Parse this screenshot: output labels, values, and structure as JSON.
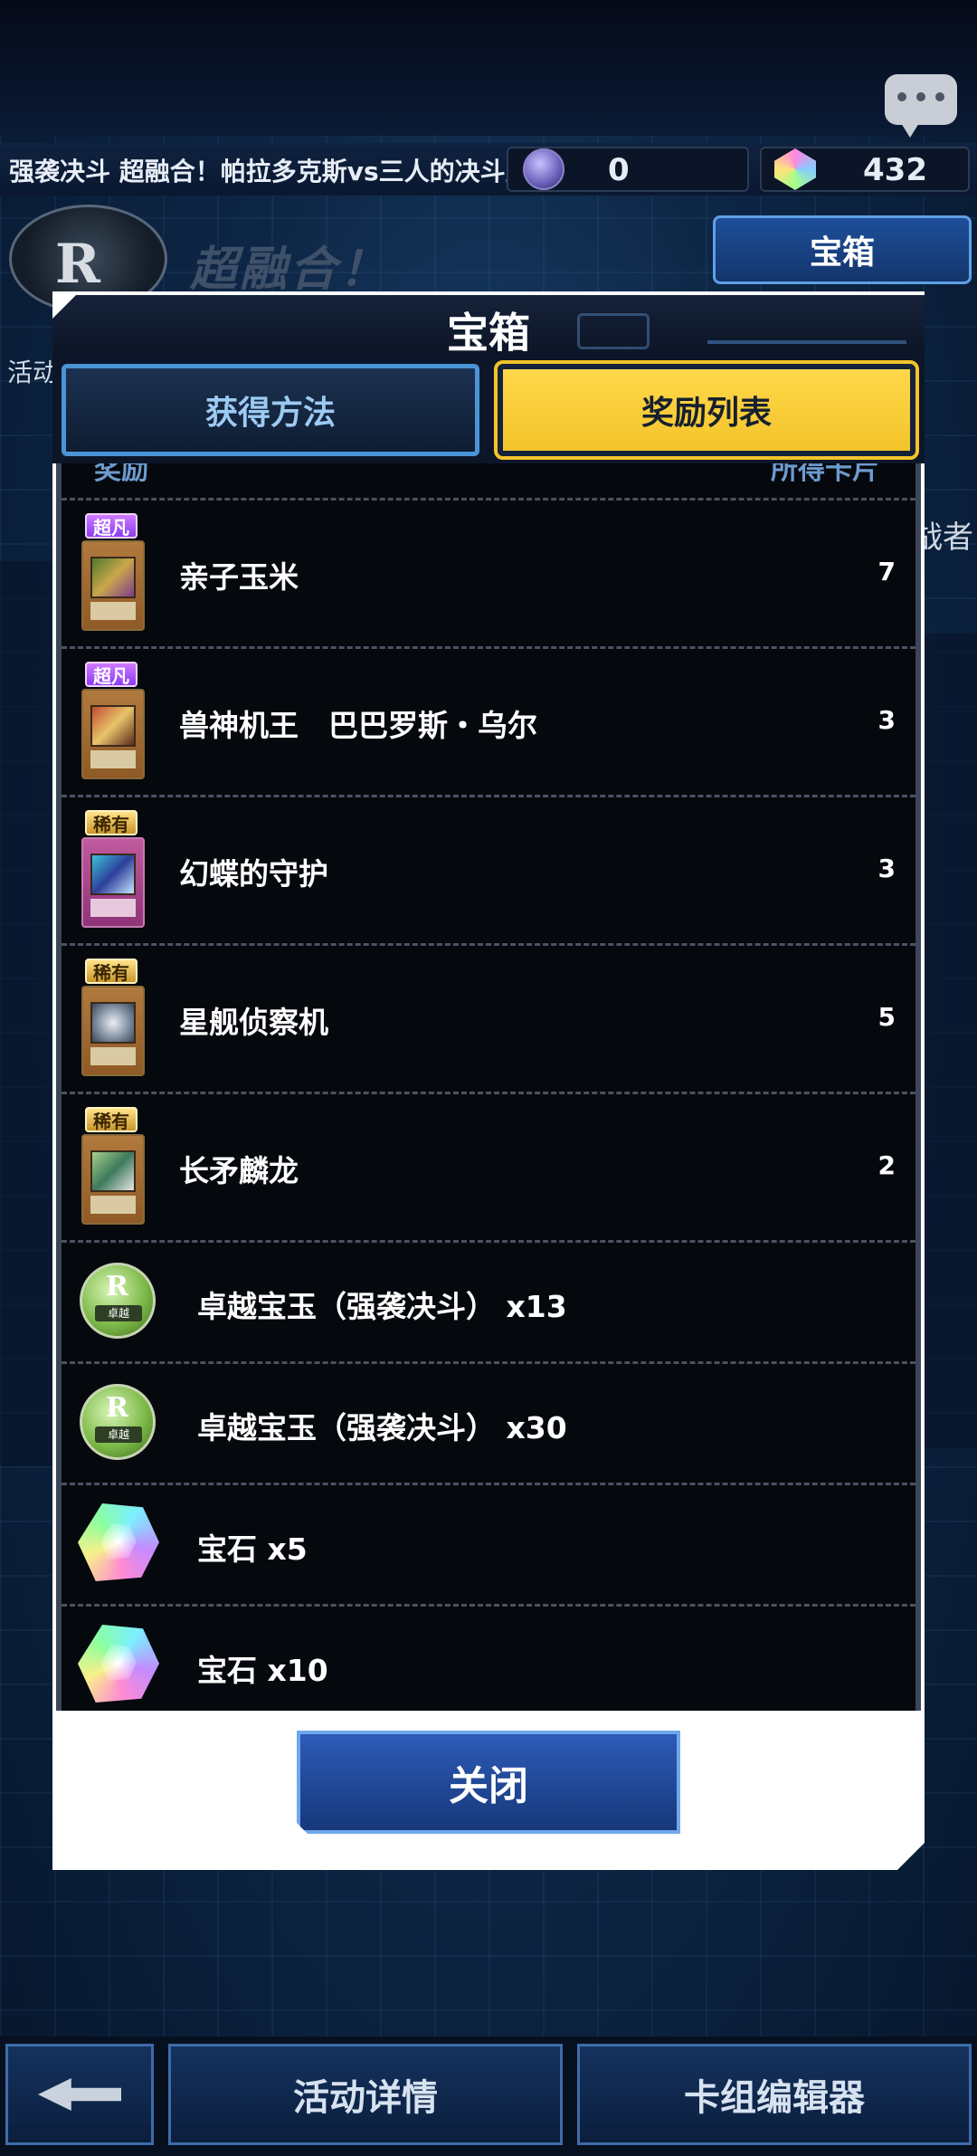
{
  "top_bar": {
    "event_title": "强袭决斗 超融合！帕拉多克斯vs三人的决斗王",
    "orb_count": "0",
    "gem_count": "432"
  },
  "banner": {
    "logo_letter": "R",
    "title": "超融合！",
    "treasure_button": "宝箱",
    "left_label": "活动",
    "right_label": "战者"
  },
  "modal": {
    "title": "宝箱",
    "tabs": [
      {
        "label": "获得方法",
        "active": false
      },
      {
        "label": "奖励列表",
        "active": true
      }
    ],
    "list_header": {
      "left": "奖励",
      "right": "所得卡片"
    },
    "card_rewards": [
      {
        "rarity": "超凡",
        "name": "亲子玉米",
        "qty": "7"
      },
      {
        "rarity": "超凡",
        "name": "兽神机王　巴巴罗斯・乌尔",
        "qty": "3"
      },
      {
        "rarity": "稀有",
        "name": "幻蝶的守护",
        "qty": "3"
      },
      {
        "rarity": "稀有",
        "name": "星舰侦察机",
        "qty": "5"
      },
      {
        "rarity": "稀有",
        "name": "长矛麟龙",
        "qty": "2"
      }
    ],
    "item_rewards": [
      {
        "icon": "medal-icon",
        "name": "卓越宝玉（强袭决斗） x13",
        "medal_label": "卓越"
      },
      {
        "icon": "medal-icon",
        "name": "卓越宝玉（强袭决斗） x30",
        "medal_label": "卓越"
      },
      {
        "icon": "gem-icon",
        "name": "宝石 x5"
      },
      {
        "icon": "gem-icon",
        "name": "宝石 x10"
      }
    ],
    "close_label": "关闭"
  },
  "bottom_nav": {
    "detail": "活动详情",
    "deck_editor": "卡组编辑器"
  },
  "colors": {
    "active_tab": "#f3c42b",
    "inactive_tab_border": "#4a94d6",
    "button_blue": "#17387a"
  }
}
